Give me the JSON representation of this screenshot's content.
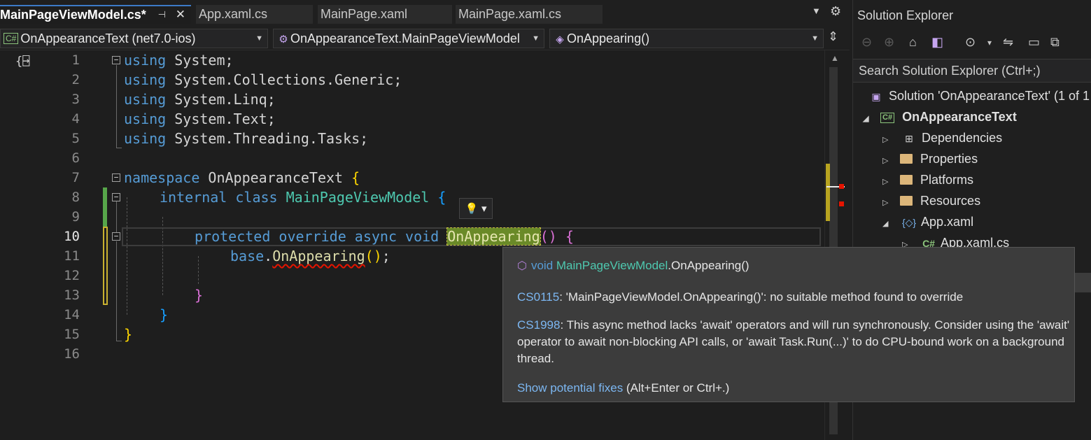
{
  "tabs": [
    {
      "label": "MainPageViewModel.cs*",
      "active": true
    },
    {
      "label": "App.xaml.cs",
      "active": false
    },
    {
      "label": "MainPage.xaml",
      "active": false
    },
    {
      "label": "MainPage.xaml.cs",
      "active": false
    }
  ],
  "tab_icons": {
    "pin": "⊣",
    "close": "✕",
    "dropdown": "▼",
    "gear": "⚙"
  },
  "navbar": {
    "project": "OnAppearanceText (net7.0-ios)",
    "type": "OnAppearanceText.MainPageViewModel",
    "member": "OnAppearing()"
  },
  "editor": {
    "line_numbers": [
      "1",
      "2",
      "3",
      "4",
      "5",
      "6",
      "7",
      "8",
      "9",
      "10",
      "11",
      "12",
      "13",
      "14",
      "15",
      "16"
    ],
    "current_line": "10",
    "code": {
      "l1_kw": "using",
      "l1_rest": " System;",
      "l2_kw": "using",
      "l2_rest": " System.Collections.Generic;",
      "l3_kw": "using",
      "l3_rest": " System.Linq;",
      "l4_kw": "using",
      "l4_rest": " System.Text;",
      "l5_kw": "using",
      "l5_rest": " System.Threading.Tasks;",
      "l7_kw": "namespace",
      "l7_name": " OnAppearanceText ",
      "l7_brace": "{",
      "l8_kw": "internal class",
      "l8_space": " ",
      "l8_type": "MainPageViewModel",
      "l8_sp2": " ",
      "l8_brace": "{",
      "l10_kw": "protected override async void",
      "l10_space": " ",
      "l10_method": "OnAppearing",
      "l10_parens": "()",
      "l10_sp": " ",
      "l10_brace": "{",
      "l11_kw": "base",
      "l11_dot": ".",
      "l11_method": "OnAppearing",
      "l11_parens": "()",
      "l11_semi": ";",
      "l13_brace": "}",
      "l14_brace": "}",
      "l15_brace": "}"
    }
  },
  "lightbulb": {
    "icon": "lightbulb-icon",
    "glyph": "💡",
    "arrow": "▾"
  },
  "solution_explorer": {
    "title": "Solution Explorer",
    "search_placeholder": "Search Solution Explorer (Ctrl+;)",
    "toolbar_glyphs": [
      "⊖",
      "⊕",
      "⌂",
      "◧",
      "⊙",
      "▾",
      "⇋",
      "▭",
      "⧉"
    ],
    "tree": [
      {
        "label": "Solution 'OnAppearanceText' (1 of 1",
        "expander": "",
        "icon": "solution-icon"
      },
      {
        "label": "OnAppearanceText",
        "expander": "◢",
        "icon": "csharp-project-icon",
        "bold": true
      },
      {
        "label": "Dependencies",
        "expander": "▷",
        "icon": "dependencies-icon"
      },
      {
        "label": "Properties",
        "expander": "▷",
        "icon": "properties-folder-icon"
      },
      {
        "label": "Platforms",
        "expander": "▷",
        "icon": "folder-icon"
      },
      {
        "label": "Resources",
        "expander": "▷",
        "icon": "folder-icon"
      },
      {
        "label": "App.xaml",
        "expander": "◢",
        "icon": "xaml-file-icon"
      },
      {
        "label": "App.xaml.cs",
        "expander": "▷",
        "icon": "csharp-file-icon"
      }
    ]
  },
  "tooltip": {
    "signature_kw": "void",
    "signature_type": "MainPageViewModel",
    "signature_rest": ".OnAppearing()",
    "error1_code": "CS0115",
    "error1_text": ": 'MainPageViewModel.OnAppearing()': no suitable method found to override",
    "error2_code": "CS1998",
    "error2_text": ": This async method lacks 'await' operators and will run synchronously. Consider using the 'await' operator to await non-blocking API calls, or 'await Task.Run(...)' to do CPU-bound work on a background thread.",
    "fix_link": "Show potential fixes",
    "fix_shortcut": " (Alt+Enter or Ctrl+.)"
  },
  "colors": {
    "keyword": "#569cd6",
    "type": "#4ec9b0",
    "method": "#dcdcaa",
    "error_squiggle": "#e51400",
    "link": "#7cb7f2"
  }
}
